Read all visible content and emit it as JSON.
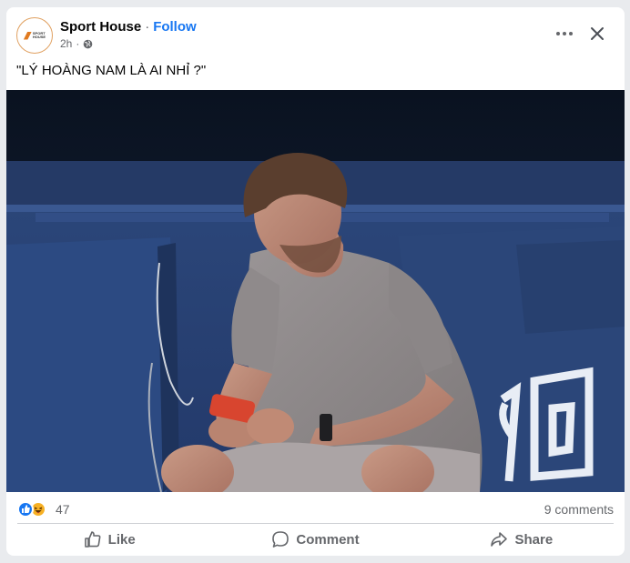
{
  "post": {
    "page_name": "Sport House",
    "separator": "·",
    "follow_label": "Follow",
    "time": "2h",
    "time_separator": "·",
    "caption": "\"LÝ HOÀNG NAM LÀ AI NHỈ ?\"",
    "avatar_text_line1": "SPORT",
    "avatar_text_line2": "HOUSE",
    "more_icon": "more-horizontal-icon",
    "close_icon": "close-icon",
    "privacy_icon": "globe-icon"
  },
  "reactions": {
    "count": "47",
    "types": [
      "like",
      "haha"
    ],
    "comments": "9 comments"
  },
  "actions": {
    "like": "Like",
    "comment": "Comment",
    "share": "Share"
  },
  "colors": {
    "accent": "#1877f2",
    "secondary_text": "#65676b",
    "court_blue": "#2f4f8a"
  }
}
